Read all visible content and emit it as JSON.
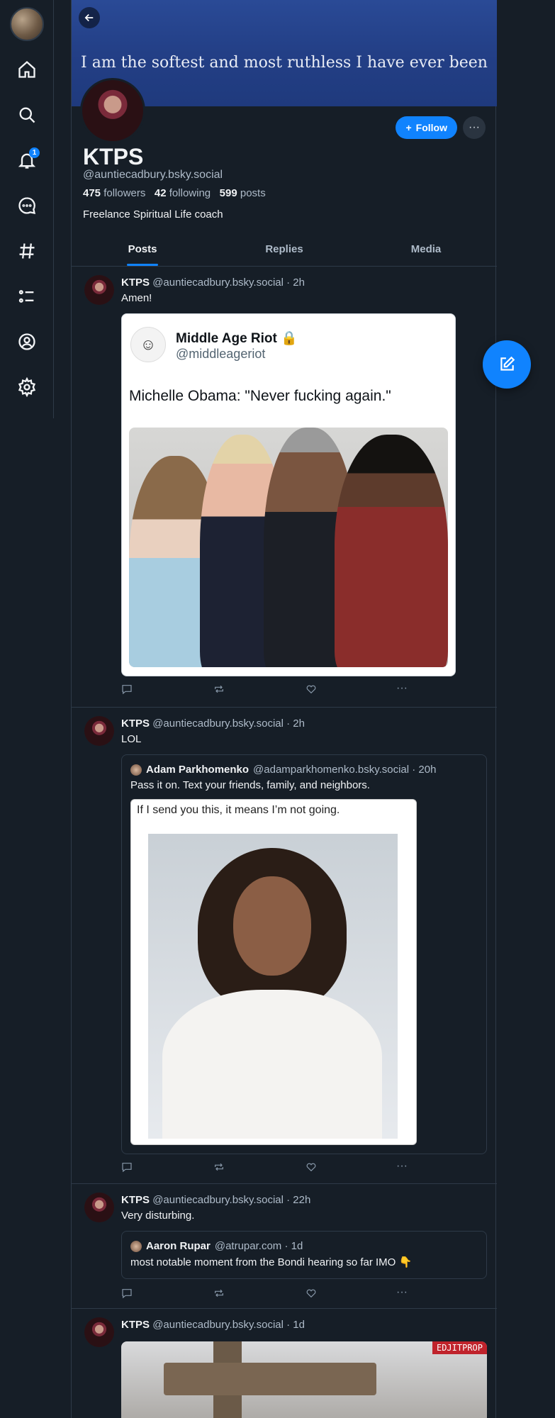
{
  "nav": {
    "notifications_count": "1"
  },
  "profile": {
    "banner_text": "I am the softest and most ruthless I have ever been",
    "name": "KTPS",
    "handle": "@auntiecadbury.bsky.social",
    "followers_count": "475",
    "followers_label": "followers",
    "following_count": "42",
    "following_label": "following",
    "posts_count": "599",
    "posts_label": "posts",
    "bio": "Freelance Spiritual Life coach",
    "follow_label": "Follow",
    "more_label": "···"
  },
  "tabs": [
    {
      "label": "Posts",
      "active": true
    },
    {
      "label": "Replies",
      "active": false
    },
    {
      "label": "Media",
      "active": false
    }
  ],
  "posts": [
    {
      "author": "KTPS",
      "meta": "@auntiecadbury.bsky.social · 2h",
      "text": "Amen!",
      "embed": {
        "name": "Middle Age Riot",
        "handle": "@middleageriot",
        "text": "Michelle Obama: \"Never fucking again.\""
      }
    },
    {
      "author": "KTPS",
      "meta": "@auntiecadbury.bsky.social · 2h",
      "text": "LOL",
      "quote": {
        "author": "Adam Parkhomenko",
        "meta": "@adamparkhomenko.bsky.social · 20h",
        "text": "Pass it on. Text your friends, family, and neighbors.",
        "image_caption": "If I send you this, it means I’m not going."
      }
    },
    {
      "author": "KTPS",
      "meta": "@auntiecadbury.bsky.social · 22h",
      "text": "Very disturbing.",
      "quote": {
        "author": "Aaron Rupar",
        "meta": "@atrupar.com · 1d",
        "text": "most notable moment from the Bondi hearing so far IMO 👇"
      }
    },
    {
      "author": "KTPS",
      "meta": "@auntiecadbury.bsky.social · 1d",
      "image_tag": "EDJITPROP"
    }
  ],
  "more_dots": "···",
  "colors": {
    "accent": "#1083fe",
    "background": "#161e27",
    "banner": "#233f86"
  }
}
